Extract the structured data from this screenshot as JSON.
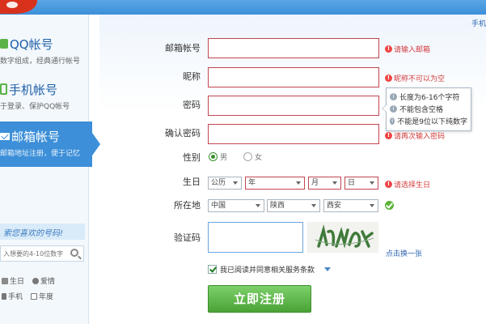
{
  "header": {
    "mobile_link": "手机"
  },
  "sidebar": {
    "items": [
      {
        "label": "QQ帐号",
        "sub": "数字组成，经典通行帐号"
      },
      {
        "label": "手机帐号",
        "sub": "于登录、保护QQ帐号"
      },
      {
        "label": "邮箱帐号",
        "sub": "邮箱地址注册，便于记忆"
      }
    ],
    "search_banner": "索您喜欢的号码!",
    "search_placeholder": "入想要的4-10位数字",
    "tags_row1": [
      "生日",
      "爱情"
    ],
    "tags_row2": [
      "手机",
      "年度"
    ]
  },
  "form": {
    "email_label": "邮箱帐号",
    "email_value": "",
    "email_error": "请输入邮箱",
    "nickname_label": "昵称",
    "nickname_value": "",
    "nickname_error": "昵称不可以为空",
    "password_label": "密码",
    "password_value": "",
    "password_tips": [
      "长度为6-16个字符",
      "不能包含空格",
      "不能是9位以下纯数字"
    ],
    "confirm_label": "确认密码",
    "confirm_value": "",
    "confirm_error": "请再次输入密码",
    "gender_label": "性别",
    "gender_options": [
      "男",
      "女"
    ],
    "gender_selected": "男",
    "birthday_label": "生日",
    "birthday_calendar": "公历",
    "birthday_year": "年",
    "birthday_month": "月",
    "birthday_day": "日",
    "birthday_error": "请选择生日",
    "location_label": "所在地",
    "location_country": "中国",
    "location_province": "陕西",
    "location_city": "西安",
    "captcha_label": "验证码",
    "captcha_value": "",
    "captcha_refresh": "点击换一张",
    "agree_text": "我已阅读并同意相关服务条款",
    "submit_label": "立即注册"
  }
}
